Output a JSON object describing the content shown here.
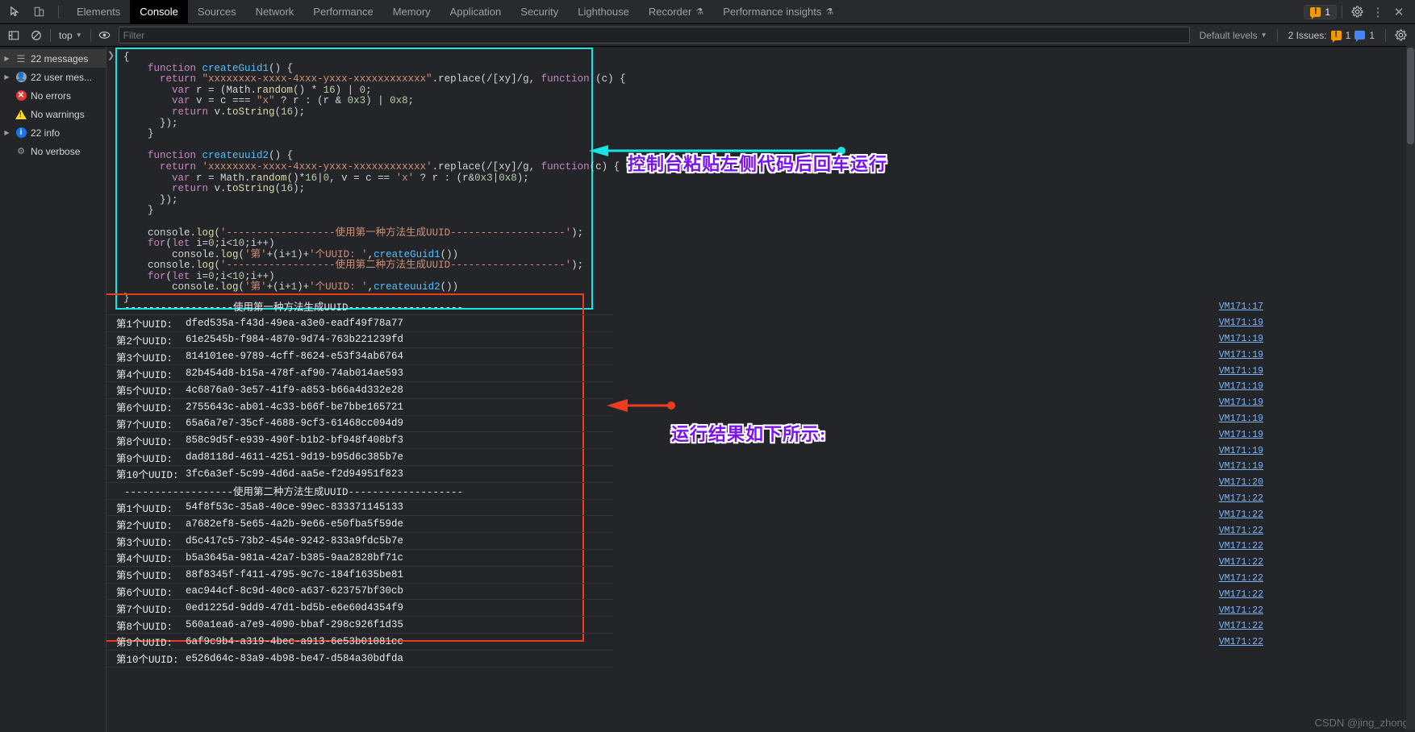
{
  "tabbar": {
    "icons": [
      {
        "name": "inspect-element-icon",
        "glyph": "⬉"
      },
      {
        "name": "device-toolbar-icon",
        "glyph": "▯"
      }
    ],
    "tabs": [
      {
        "label": "Elements",
        "active": false,
        "experiment": false
      },
      {
        "label": "Console",
        "active": true,
        "experiment": false
      },
      {
        "label": "Sources",
        "active": false,
        "experiment": false
      },
      {
        "label": "Network",
        "active": false,
        "experiment": false
      },
      {
        "label": "Performance",
        "active": false,
        "experiment": false
      },
      {
        "label": "Memory",
        "active": false,
        "experiment": false
      },
      {
        "label": "Application",
        "active": false,
        "experiment": false
      },
      {
        "label": "Security",
        "active": false,
        "experiment": false
      },
      {
        "label": "Lighthouse",
        "active": false,
        "experiment": false
      },
      {
        "label": "Recorder",
        "active": false,
        "experiment": true
      },
      {
        "label": "Performance insights",
        "active": false,
        "experiment": true
      }
    ],
    "warning_count": "1",
    "settings_label": "gear-icon",
    "more_label": "more-options-icon",
    "close_label": "close-icon"
  },
  "filterbar": {
    "sidebar_toggle": "show-console-sidebar-icon",
    "clear_console": "clear-console-icon",
    "context": "top",
    "eye_label": "live-expression-icon",
    "filter_placeholder": "Filter",
    "filter_value": "",
    "levels": "Default levels",
    "issues_label": "2 Issues:",
    "issues_warning_count": "1",
    "issues_info_count": "1"
  },
  "sidebar": {
    "items": [
      {
        "label": "22 messages",
        "icon": "message-list-icon",
        "expandable": true,
        "selected": true
      },
      {
        "label": "22 user mes...",
        "icon": "user-message-icon",
        "expandable": true,
        "selected": false
      },
      {
        "label": "No errors",
        "icon": "error-icon",
        "expandable": false,
        "selected": false
      },
      {
        "label": "No warnings",
        "icon": "warning-icon",
        "expandable": false,
        "selected": false
      },
      {
        "label": "22 info",
        "icon": "info-icon",
        "expandable": true,
        "selected": false
      },
      {
        "label": "No verbose",
        "icon": "verbose-icon",
        "expandable": false,
        "selected": false
      }
    ]
  },
  "code": {
    "lines": [
      [
        {
          "t": "{",
          "c": "pl"
        }
      ],
      [
        {
          "t": "    ",
          "c": "pl"
        },
        {
          "t": "function",
          "c": "kw"
        },
        {
          "t": " ",
          "c": "pl"
        },
        {
          "t": "createGuid1",
          "c": "fn"
        },
        {
          "t": "() {",
          "c": "pl"
        }
      ],
      [
        {
          "t": "      ",
          "c": "pl"
        },
        {
          "t": "return",
          "c": "kw"
        },
        {
          "t": " ",
          "c": "pl"
        },
        {
          "t": "\"xxxxxxxx-xxxx-4xxx-yxxx-xxxxxxxxxxxx\"",
          "c": "str"
        },
        {
          "t": ".replace(/[xy]/g, ",
          "c": "pl"
        },
        {
          "t": "function",
          "c": "kw"
        },
        {
          "t": " (c) {",
          "c": "pl"
        }
      ],
      [
        {
          "t": "        ",
          "c": "pl"
        },
        {
          "t": "var",
          "c": "kw"
        },
        {
          "t": " r = (Math.",
          "c": "pl"
        },
        {
          "t": "random",
          "c": "mth"
        },
        {
          "t": "() * ",
          "c": "pl"
        },
        {
          "t": "16",
          "c": "num"
        },
        {
          "t": ") | ",
          "c": "pl"
        },
        {
          "t": "0",
          "c": "num"
        },
        {
          "t": ";",
          "c": "pl"
        }
      ],
      [
        {
          "t": "        ",
          "c": "pl"
        },
        {
          "t": "var",
          "c": "kw"
        },
        {
          "t": " v = c === ",
          "c": "pl"
        },
        {
          "t": "\"x\"",
          "c": "str"
        },
        {
          "t": " ? r : (r & ",
          "c": "pl"
        },
        {
          "t": "0x3",
          "c": "num"
        },
        {
          "t": ") | ",
          "c": "pl"
        },
        {
          "t": "0x8",
          "c": "num"
        },
        {
          "t": ";",
          "c": "pl"
        }
      ],
      [
        {
          "t": "        ",
          "c": "pl"
        },
        {
          "t": "return",
          "c": "kw"
        },
        {
          "t": " v.",
          "c": "pl"
        },
        {
          "t": "toString",
          "c": "mth"
        },
        {
          "t": "(",
          "c": "pl"
        },
        {
          "t": "16",
          "c": "num"
        },
        {
          "t": ");",
          "c": "pl"
        }
      ],
      [
        {
          "t": "      });",
          "c": "pl"
        }
      ],
      [
        {
          "t": "    }",
          "c": "pl"
        }
      ],
      [
        {
          "t": "",
          "c": "pl"
        }
      ],
      [
        {
          "t": "    ",
          "c": "pl"
        },
        {
          "t": "function",
          "c": "kw"
        },
        {
          "t": " ",
          "c": "pl"
        },
        {
          "t": "createuuid2",
          "c": "fn"
        },
        {
          "t": "() {",
          "c": "pl"
        }
      ],
      [
        {
          "t": "      ",
          "c": "pl"
        },
        {
          "t": "return",
          "c": "kw"
        },
        {
          "t": " ",
          "c": "pl"
        },
        {
          "t": "'xxxxxxxx-xxxx-4xxx-yxxx-xxxxxxxxxxxx'",
          "c": "str"
        },
        {
          "t": ".replace(/[xy]/g, ",
          "c": "pl"
        },
        {
          "t": "function",
          "c": "kw"
        },
        {
          "t": "(c) {",
          "c": "pl"
        }
      ],
      [
        {
          "t": "        ",
          "c": "pl"
        },
        {
          "t": "var",
          "c": "kw"
        },
        {
          "t": " r = Math.",
          "c": "pl"
        },
        {
          "t": "random",
          "c": "mth"
        },
        {
          "t": "()*",
          "c": "pl"
        },
        {
          "t": "16",
          "c": "num"
        },
        {
          "t": "|",
          "c": "pl"
        },
        {
          "t": "0",
          "c": "num"
        },
        {
          "t": ", v = c == ",
          "c": "pl"
        },
        {
          "t": "'x'",
          "c": "str"
        },
        {
          "t": " ? r : (r&",
          "c": "pl"
        },
        {
          "t": "0x3",
          "c": "num"
        },
        {
          "t": "|",
          "c": "pl"
        },
        {
          "t": "0x8",
          "c": "num"
        },
        {
          "t": ");",
          "c": "pl"
        }
      ],
      [
        {
          "t": "        ",
          "c": "pl"
        },
        {
          "t": "return",
          "c": "kw"
        },
        {
          "t": " v.",
          "c": "pl"
        },
        {
          "t": "toString",
          "c": "mth"
        },
        {
          "t": "(",
          "c": "pl"
        },
        {
          "t": "16",
          "c": "num"
        },
        {
          "t": ");",
          "c": "pl"
        }
      ],
      [
        {
          "t": "      });",
          "c": "pl"
        }
      ],
      [
        {
          "t": "    }",
          "c": "pl"
        }
      ],
      [
        {
          "t": "",
          "c": "pl"
        }
      ],
      [
        {
          "t": "    console.",
          "c": "pl"
        },
        {
          "t": "log",
          "c": "mth"
        },
        {
          "t": "(",
          "c": "pl"
        },
        {
          "t": "'------------------使用第一种方法生成UUID-------------------'",
          "c": "str"
        },
        {
          "t": ");",
          "c": "pl"
        }
      ],
      [
        {
          "t": "    ",
          "c": "pl"
        },
        {
          "t": "for",
          "c": "kw"
        },
        {
          "t": "(",
          "c": "pl"
        },
        {
          "t": "let",
          "c": "kw"
        },
        {
          "t": " i=",
          "c": "pl"
        },
        {
          "t": "0",
          "c": "num"
        },
        {
          "t": ";i<",
          "c": "pl"
        },
        {
          "t": "10",
          "c": "num"
        },
        {
          "t": ";i++)",
          "c": "pl"
        }
      ],
      [
        {
          "t": "        console.",
          "c": "pl"
        },
        {
          "t": "log",
          "c": "mth"
        },
        {
          "t": "(",
          "c": "pl"
        },
        {
          "t": "'第'",
          "c": "str"
        },
        {
          "t": "+(i+",
          "c": "pl"
        },
        {
          "t": "1",
          "c": "num"
        },
        {
          "t": ")+",
          "c": "pl"
        },
        {
          "t": "'个UUID: '",
          "c": "str"
        },
        {
          "t": ",",
          "c": "pl"
        },
        {
          "t": "createGuid1",
          "c": "fn"
        },
        {
          "t": "())",
          "c": "pl"
        }
      ],
      [
        {
          "t": "    console.",
          "c": "pl"
        },
        {
          "t": "log",
          "c": "mth"
        },
        {
          "t": "(",
          "c": "pl"
        },
        {
          "t": "'------------------使用第二种方法生成UUID-------------------'",
          "c": "str"
        },
        {
          "t": ");",
          "c": "pl"
        }
      ],
      [
        {
          "t": "    ",
          "c": "pl"
        },
        {
          "t": "for",
          "c": "kw"
        },
        {
          "t": "(",
          "c": "pl"
        },
        {
          "t": "let",
          "c": "kw"
        },
        {
          "t": " i=",
          "c": "pl"
        },
        {
          "t": "0",
          "c": "num"
        },
        {
          "t": ";i<",
          "c": "pl"
        },
        {
          "t": "10",
          "c": "num"
        },
        {
          "t": ";i++)",
          "c": "pl"
        }
      ],
      [
        {
          "t": "        console.",
          "c": "pl"
        },
        {
          "t": "log",
          "c": "mth"
        },
        {
          "t": "(",
          "c": "pl"
        },
        {
          "t": "'第'",
          "c": "str"
        },
        {
          "t": "+(i+",
          "c": "pl"
        },
        {
          "t": "1",
          "c": "num"
        },
        {
          "t": ")+",
          "c": "pl"
        },
        {
          "t": "'个UUID: '",
          "c": "str"
        },
        {
          "t": ",",
          "c": "pl"
        },
        {
          "t": "createuuid2",
          "c": "fn"
        },
        {
          "t": "())",
          "c": "pl"
        }
      ],
      [
        {
          "t": "}",
          "c": "pl"
        }
      ]
    ]
  },
  "output": {
    "rows": [
      {
        "label": "",
        "value": "------------------使用第一种方法生成UUID-------------------",
        "source": "VM171:17",
        "divider": true
      },
      {
        "label": "第1个UUID: ",
        "value": "dfed535a-f43d-49ea-a3e0-eadf49f78a77",
        "source": "VM171:19"
      },
      {
        "label": "第2个UUID: ",
        "value": "61e2545b-f984-4870-9d74-763b221239fd",
        "source": "VM171:19"
      },
      {
        "label": "第3个UUID: ",
        "value": "814101ee-9789-4cff-8624-e53f34ab6764",
        "source": "VM171:19"
      },
      {
        "label": "第4个UUID: ",
        "value": "82b454d8-b15a-478f-af90-74ab014ae593",
        "source": "VM171:19"
      },
      {
        "label": "第5个UUID: ",
        "value": "4c6876a0-3e57-41f9-a853-b66a4d332e28",
        "source": "VM171:19"
      },
      {
        "label": "第6个UUID: ",
        "value": "2755643c-ab01-4c33-b66f-be7bbe165721",
        "source": "VM171:19"
      },
      {
        "label": "第7个UUID: ",
        "value": "65a6a7e7-35cf-4688-9cf3-61468cc094d9",
        "source": "VM171:19"
      },
      {
        "label": "第8个UUID: ",
        "value": "858c9d5f-e939-490f-b1b2-bf948f408bf3",
        "source": "VM171:19"
      },
      {
        "label": "第9个UUID: ",
        "value": "dad8118d-4611-4251-9d19-b95d6c385b7e",
        "source": "VM171:19"
      },
      {
        "label": "第10个UUID: ",
        "value": "3fc6a3ef-5c99-4d6d-aa5e-f2d94951f823",
        "source": "VM171:19"
      },
      {
        "label": "",
        "value": "------------------使用第二种方法生成UUID-------------------",
        "source": "VM171:20",
        "divider": true
      },
      {
        "label": "第1个UUID: ",
        "value": "54f8f53c-35a8-40ce-99ec-833371145133",
        "source": "VM171:22"
      },
      {
        "label": "第2个UUID: ",
        "value": "a7682ef8-5e65-4a2b-9e66-e50fba5f59de",
        "source": "VM171:22"
      },
      {
        "label": "第3个UUID: ",
        "value": "d5c417c5-73b2-454e-9242-833a9fdc5b7e",
        "source": "VM171:22"
      },
      {
        "label": "第4个UUID: ",
        "value": "b5a3645a-981a-42a7-b385-9aa2828bf71c",
        "source": "VM171:22"
      },
      {
        "label": "第5个UUID: ",
        "value": "88f8345f-f411-4795-9c7c-184f1635be81",
        "source": "VM171:22"
      },
      {
        "label": "第6个UUID: ",
        "value": "eac944cf-8c9d-40c0-a637-623757bf30cb",
        "source": "VM171:22"
      },
      {
        "label": "第7个UUID: ",
        "value": "0ed1225d-9dd9-47d1-bd5b-e6e60d4354f9",
        "source": "VM171:22"
      },
      {
        "label": "第8个UUID: ",
        "value": "560a1ea6-a7e9-4090-bbaf-298c926f1d35",
        "source": "VM171:22"
      },
      {
        "label": "第9个UUID: ",
        "value": "6af9c9b4-a319-4bec-a913-6e53b01081cc",
        "source": "VM171:22"
      },
      {
        "label": "第10个UUID: ",
        "value": "e526d64c-83a9-4b98-be47-d584a30bdfda",
        "source": "VM171:22"
      }
    ]
  },
  "annotations": {
    "code_note": "控制台粘贴左侧代码后回车运行",
    "result_note": "运行结果如下所示:"
  },
  "watermark": "CSDN @jing_zhong",
  "colors": {
    "code_border": "#18e3e3",
    "output_border": "#f03c1e",
    "annotation_text": "#7a12f0",
    "annotation_outline": "#ffffff",
    "link": "#7cb3f3"
  }
}
